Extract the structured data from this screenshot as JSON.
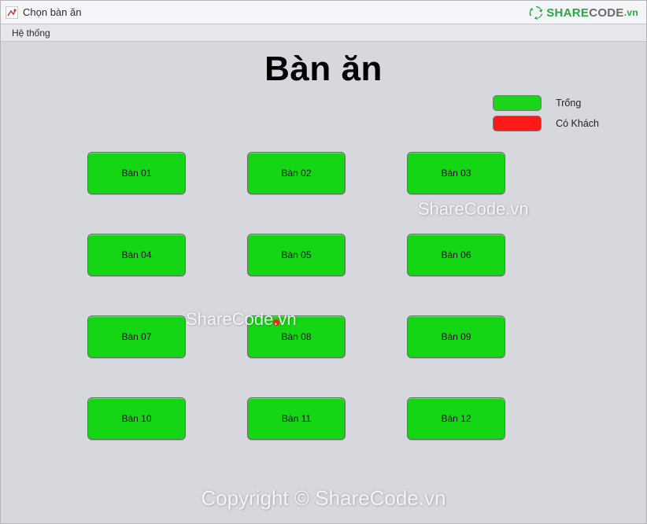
{
  "window": {
    "title": "Chọn bàn ăn"
  },
  "menubar": {
    "system": "Hệ thống"
  },
  "page": {
    "title": "Bàn ăn"
  },
  "legend": {
    "empty": "Trống",
    "occupied": "Có Khách"
  },
  "colors": {
    "empty": "#14d614",
    "occupied": "#ff1a1a"
  },
  "tables": [
    {
      "label": "Bàn 01",
      "status": "empty"
    },
    {
      "label": "Bàn 02",
      "status": "empty"
    },
    {
      "label": "Bàn 03",
      "status": "empty"
    },
    {
      "label": "Bàn 04",
      "status": "empty"
    },
    {
      "label": "Bàn 05",
      "status": "empty"
    },
    {
      "label": "Bàn 06",
      "status": "empty"
    },
    {
      "label": "Bàn 07",
      "status": "empty"
    },
    {
      "label": "Bàn 08",
      "status": "empty"
    },
    {
      "label": "Bàn 09",
      "status": "empty"
    },
    {
      "label": "Bàn 10",
      "status": "empty"
    },
    {
      "label": "Bàn 11",
      "status": "empty"
    },
    {
      "label": "Bàn 12",
      "status": "empty"
    }
  ],
  "brand": {
    "share": "SHARE",
    "code": "CODE",
    "suffix": ".vn"
  },
  "watermark": {
    "wm1": "ShareCode.vn",
    "wm2": "ShareCode.vn",
    "wm3": "Copyright © ShareCode.vn"
  }
}
